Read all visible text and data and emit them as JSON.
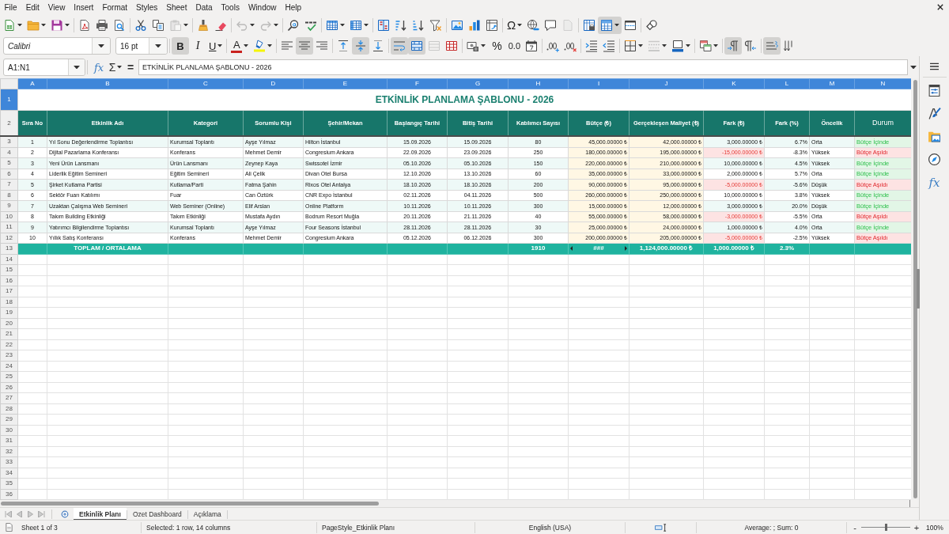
{
  "menu": [
    "File",
    "Edit",
    "View",
    "Insert",
    "Format",
    "Styles",
    "Sheet",
    "Data",
    "Tools",
    "Window",
    "Help"
  ],
  "toolbar_standard": [
    [
      {
        "kind": "new",
        "pressed": false,
        "disabled": false
      },
      {
        "kind": "open",
        "pressed": false,
        "disabled": false
      },
      {
        "kind": "save",
        "pressed": false,
        "disabled": false
      }
    ],
    [
      {
        "kind": "pdf",
        "pressed": false,
        "disabled": false
      },
      {
        "kind": "print",
        "pressed": false,
        "disabled": false
      },
      {
        "kind": "preview",
        "pressed": false,
        "disabled": false
      }
    ],
    [
      {
        "kind": "cut",
        "pressed": false,
        "disabled": false
      },
      {
        "kind": "copy",
        "pressed": false,
        "disabled": false
      },
      {
        "kind": "paste",
        "pressed": false,
        "disabled": true
      }
    ],
    [
      {
        "kind": "clone",
        "pressed": false,
        "disabled": false
      },
      {
        "kind": "clear",
        "pressed": false,
        "disabled": false
      }
    ],
    [
      {
        "kind": "undo",
        "pressed": false,
        "disabled": true
      },
      {
        "kind": "redo",
        "pressed": false,
        "disabled": true
      }
    ],
    [
      {
        "kind": "find",
        "pressed": false,
        "disabled": false
      },
      {
        "kind": "spelling",
        "pressed": false,
        "disabled": false
      }
    ],
    [
      {
        "kind": "rows",
        "pressed": false,
        "disabled": false
      },
      {
        "kind": "columns",
        "pressed": false,
        "disabled": false
      }
    ],
    [
      {
        "kind": "sort",
        "pressed": false,
        "disabled": false
      },
      {
        "kind": "sortasc",
        "pressed": false,
        "disabled": false
      },
      {
        "kind": "sortdesc",
        "pressed": false,
        "disabled": false
      },
      {
        "kind": "filter",
        "pressed": false,
        "disabled": false
      }
    ],
    [
      {
        "kind": "image",
        "pressed": false,
        "disabled": false
      },
      {
        "kind": "chart",
        "pressed": false,
        "disabled": false
      },
      {
        "kind": "pivot",
        "pressed": false,
        "disabled": false
      }
    ],
    [
      {
        "kind": "specialchar",
        "label": "Ω",
        "pressed": false,
        "disabled": false
      },
      {
        "kind": "hyperlink",
        "pressed": false,
        "disabled": false
      },
      {
        "kind": "comment",
        "pressed": false,
        "disabled": false
      },
      {
        "kind": "headerfooter",
        "pressed": false,
        "disabled": true
      }
    ],
    [
      {
        "kind": "printarea",
        "pressed": false,
        "disabled": false
      },
      {
        "kind": "freeze",
        "pressed": true,
        "disabled": false
      },
      {
        "kind": "split",
        "pressed": false,
        "disabled": false
      }
    ],
    [
      {
        "kind": "draw",
        "pressed": false,
        "disabled": false
      }
    ]
  ],
  "toolbar_formatting": {
    "font_name": "Calibri",
    "font_size": "16 pt",
    "groups": [
      [
        {
          "kind": "bold",
          "label": "B",
          "pressed": true,
          "disabled": false
        },
        {
          "kind": "italic",
          "label": "I",
          "pressed": false,
          "disabled": false
        },
        {
          "kind": "underline",
          "label": "U",
          "pressed": false,
          "disabled": false
        }
      ],
      [
        {
          "kind": "fontcolor",
          "label": "A",
          "pressed": false,
          "disabled": false
        },
        {
          "kind": "highlight",
          "pressed": false,
          "disabled": false
        }
      ],
      [
        {
          "kind": "alignleft",
          "pressed": false,
          "disabled": false
        },
        {
          "kind": "aligncenter",
          "pressed": true,
          "disabled": false
        },
        {
          "kind": "alignright",
          "pressed": false,
          "disabled": false
        }
      ],
      [
        {
          "kind": "aligntop",
          "pressed": false,
          "disabled": false
        },
        {
          "kind": "alignmiddle",
          "pressed": true,
          "disabled": false
        },
        {
          "kind": "alignbottom",
          "pressed": false,
          "disabled": false
        }
      ],
      [
        {
          "kind": "wrap",
          "pressed": true,
          "disabled": false
        },
        {
          "kind": "mergecenter",
          "pressed": true,
          "disabled": false
        },
        {
          "kind": "merge",
          "pressed": false,
          "disabled": true
        },
        {
          "kind": "unmerge",
          "pressed": false,
          "disabled": false
        }
      ],
      [
        {
          "kind": "currency",
          "pressed": false,
          "disabled": false
        },
        {
          "kind": "percent",
          "label": "%",
          "pressed": false,
          "disabled": false
        },
        {
          "kind": "number",
          "label": "0.0",
          "pressed": false,
          "disabled": false
        },
        {
          "kind": "date",
          "pressed": false,
          "disabled": false
        }
      ],
      [
        {
          "kind": "adddecimal",
          "pressed": false,
          "disabled": false
        },
        {
          "kind": "deldecimal",
          "pressed": false,
          "disabled": false
        }
      ],
      [
        {
          "kind": "indent",
          "pressed": false,
          "disabled": false
        },
        {
          "kind": "outdent",
          "pressed": false,
          "disabled": false
        }
      ],
      [
        {
          "kind": "borders",
          "pressed": false,
          "disabled": false
        },
        {
          "kind": "borderstyle",
          "pressed": false,
          "disabled": true
        },
        {
          "kind": "bordercolor",
          "pressed": false,
          "disabled": false
        }
      ],
      [
        {
          "kind": "conditional",
          "pressed": false,
          "disabled": false
        }
      ],
      [
        {
          "kind": "ltr",
          "pressed": true,
          "disabled": false
        },
        {
          "kind": "rtl",
          "pressed": false,
          "disabled": false
        }
      ],
      [
        {
          "kind": "horizontal",
          "pressed": true,
          "disabled": false
        },
        {
          "kind": "vertical",
          "pressed": false,
          "disabled": false
        }
      ]
    ]
  },
  "formula_bar": {
    "name_box": "A1:N1",
    "function_wizard": "fx",
    "sum": "Σ",
    "formula": "=",
    "content": "ETKİNLİK PLANLAMA ŞABLONU - 2026"
  },
  "sheet": {
    "columns": [
      {
        "letter": "A",
        "selected": true
      },
      {
        "letter": "B",
        "selected": true
      },
      {
        "letter": "C",
        "selected": true
      },
      {
        "letter": "D",
        "selected": true
      },
      {
        "letter": "E",
        "selected": true
      },
      {
        "letter": "F",
        "selected": true
      },
      {
        "letter": "G",
        "selected": true
      },
      {
        "letter": "H",
        "selected": true
      },
      {
        "letter": "I",
        "selected": true
      },
      {
        "letter": "J",
        "selected": true
      },
      {
        "letter": "K",
        "selected": true
      },
      {
        "letter": "L",
        "selected": true
      },
      {
        "letter": "M",
        "selected": true
      },
      {
        "letter": "N",
        "selected": true
      }
    ],
    "title_row": {
      "number": "1",
      "selected": true,
      "title": "ETKİNLİK PLANLAMA ŞABLONU - 2026"
    },
    "header_row": {
      "number": "2",
      "selected": false,
      "headings": [
        "Sıra No",
        "Etkinlik Adı",
        "Kategori",
        "Sorumlu Kişi",
        "Şehir/Mekan",
        "Başlangıç Tarihi",
        "Bitiş Tarihi",
        "Katılımcı Sayısı",
        "Bütçe (₺)",
        "Gerçekleşen Maliyet (₺)",
        "Fark (₺)",
        "Fark (%)",
        "Öncelik",
        "Durum"
      ]
    },
    "rows": [
      {
        "number": "3",
        "selected": false,
        "over_budget": false,
        "cells": [
          "1",
          "Yıl Sonu Değerlendirme Toplantısı",
          "Kurumsal Toplantı",
          "Ayşe Yılmaz",
          "Hilton İstanbul",
          "15.09.2026",
          "15.09.2026",
          "80",
          "45,000.00000 ₺",
          "42,000.00000 ₺",
          "3,000.00000 ₺",
          "6.7%",
          "Orta",
          "Bütçe İçinde"
        ]
      },
      {
        "number": "4",
        "selected": false,
        "over_budget": true,
        "cells": [
          "2",
          "Dijital Pazarlama Konferansı",
          "Konferans",
          "Mehmet Demir",
          "Congresium Ankara",
          "22.09.2026",
          "23.09.2026",
          "250",
          "180,000.00000 ₺",
          "195,000.00000 ₺",
          "-15,000.00000 ₺",
          "-8.3%",
          "Yüksek",
          "Bütçe Aşıldı"
        ]
      },
      {
        "number": "5",
        "selected": false,
        "over_budget": false,
        "cells": [
          "3",
          "Yeni Ürün Lansmanı",
          "Ürün Lansmanı",
          "Zeynep Kaya",
          "Swissotel İzmir",
          "05.10.2026",
          "05.10.2026",
          "150",
          "220,000.00000 ₺",
          "210,000.00000 ₺",
          "10,000.00000 ₺",
          "4.5%",
          "Yüksek",
          "Bütçe İçinde"
        ]
      },
      {
        "number": "6",
        "selected": false,
        "over_budget": false,
        "cells": [
          "4",
          "Liderlik Eğitim Semineri",
          "Eğitim Semineri",
          "Ali Çelik",
          "Divan Otel Bursa",
          "12.10.2026",
          "13.10.2026",
          "60",
          "35,000.00000 ₺",
          "33,000.00000 ₺",
          "2,000.00000 ₺",
          "5.7%",
          "Orta",
          "Bütçe İçinde"
        ]
      },
      {
        "number": "7",
        "selected": false,
        "over_budget": true,
        "cells": [
          "5",
          "Şirket Kutlama Partisi",
          "Kutlama/Parti",
          "Fatma Şahin",
          "Rixos Otel Antalya",
          "18.10.2026",
          "18.10.2026",
          "200",
          "90,000.00000 ₺",
          "95,000.00000 ₺",
          "-5,000.00000 ₺",
          "-5.6%",
          "Düşük",
          "Bütçe Aşıldı"
        ]
      },
      {
        "number": "8",
        "selected": false,
        "over_budget": false,
        "cells": [
          "6",
          "Sektör Fuarı Katılımı",
          "Fuar",
          "Can Öztürk",
          "CNR Expo İstanbul",
          "02.11.2026",
          "04.11.2026",
          "500",
          "260,000.00000 ₺",
          "250,000.00000 ₺",
          "10,000.00000 ₺",
          "3.8%",
          "Yüksek",
          "Bütçe İçinde"
        ]
      },
      {
        "number": "9",
        "selected": false,
        "over_budget": false,
        "cells": [
          "7",
          "Uzaktan Çalışma Web Semineri",
          "Web Seminer (Online)",
          "Elif Arslan",
          "Online Platform",
          "10.11.2026",
          "10.11.2026",
          "300",
          "15,000.00000 ₺",
          "12,000.00000 ₺",
          "3,000.00000 ₺",
          "20.0%",
          "Düşük",
          "Bütçe İçinde"
        ]
      },
      {
        "number": "10",
        "selected": false,
        "over_budget": true,
        "cells": [
          "8",
          "Takım Building Etkinliği",
          "Takım Etkinliği",
          "Mustafa Aydın",
          "Bodrum Resort Muğla",
          "20.11.2026",
          "21.11.2026",
          "40",
          "55,000.00000 ₺",
          "58,000.00000 ₺",
          "-3,000.00000 ₺",
          "-5.5%",
          "Orta",
          "Bütçe Aşıldı"
        ]
      },
      {
        "number": "11",
        "selected": false,
        "over_budget": false,
        "cells": [
          "9",
          "Yatırımcı Bilgilendirme Toplantısı",
          "Kurumsal Toplantı",
          "Ayşe Yılmaz",
          "Four Seasons İstanbul",
          "28.11.2026",
          "28.11.2026",
          "30",
          "25,000.00000 ₺",
          "24,000.00000 ₺",
          "1,000.00000 ₺",
          "4.0%",
          "Orta",
          "Bütçe İçinde"
        ]
      },
      {
        "number": "12",
        "selected": false,
        "over_budget": true,
        "cells": [
          "10",
          "Yıllık Satış Konferansı",
          "Konferans",
          "Mehmet Demir",
          "Congresium Ankara",
          "05.12.2026",
          "06.12.2026",
          "300",
          "200,000.00000 ₺",
          "205,000.00000 ₺",
          "-5,000.00000 ₺",
          "-2.5%",
          "Yüksek",
          "Bütçe Aşıldı"
        ]
      }
    ],
    "total_row": {
      "number": "13",
      "selected": false,
      "label": "TOPLAM / ORTALAMA",
      "participants": "1910",
      "budget": "###",
      "budget_overflow": true,
      "actual_cost": "1,124,000.00000 ₺",
      "difference": "1,000.00000 ₺",
      "difference_percent": "2.3%"
    },
    "empty_rows": [
      {
        "number": "14",
        "selected": false
      },
      {
        "number": "15",
        "selected": false
      },
      {
        "number": "16",
        "selected": false
      },
      {
        "number": "17",
        "selected": false
      },
      {
        "number": "18",
        "selected": false
      },
      {
        "number": "19",
        "selected": false
      },
      {
        "number": "20",
        "selected": false
      },
      {
        "number": "21",
        "selected": false
      },
      {
        "number": "22",
        "selected": false
      },
      {
        "number": "23",
        "selected": false
      },
      {
        "number": "24",
        "selected": false
      },
      {
        "number": "25",
        "selected": false
      },
      {
        "number": "26",
        "selected": false
      },
      {
        "number": "27",
        "selected": false
      },
      {
        "number": "28",
        "selected": false
      },
      {
        "number": "29",
        "selected": false
      },
      {
        "number": "30",
        "selected": false
      },
      {
        "number": "31",
        "selected": false
      },
      {
        "number": "32",
        "selected": false
      },
      {
        "number": "33",
        "selected": false
      },
      {
        "number": "34",
        "selected": false
      },
      {
        "number": "35",
        "selected": false
      },
      {
        "number": "36",
        "selected": false
      }
    ]
  },
  "sidebar": [
    {
      "kind": "properties",
      "selected": false
    },
    {
      "kind": "styles",
      "selected": false
    },
    {
      "kind": "gallery",
      "selected": false
    },
    {
      "kind": "navigator",
      "selected": false
    },
    {
      "kind": "functions",
      "label": "fx",
      "selected": false
    }
  ],
  "sheet_tabs": [
    {
      "label": "Etkinlik Planı",
      "selected": true
    },
    {
      "label": "Ozet Dashboard",
      "selected": false
    },
    {
      "label": "Açıklama",
      "selected": false
    }
  ],
  "status_bar": {
    "sheet_position": "Sheet 1 of 3",
    "selection": "Selected: 1 row, 14 columns",
    "page_style": "PageStyle_Etkinlik Planı",
    "language": "English (USA)",
    "summary": "Average: ; Sum: 0",
    "zoom_out": "-",
    "zoom_slider": {
      "level": 0.5
    },
    "zoom_in": "+",
    "zoom": "100%"
  }
}
